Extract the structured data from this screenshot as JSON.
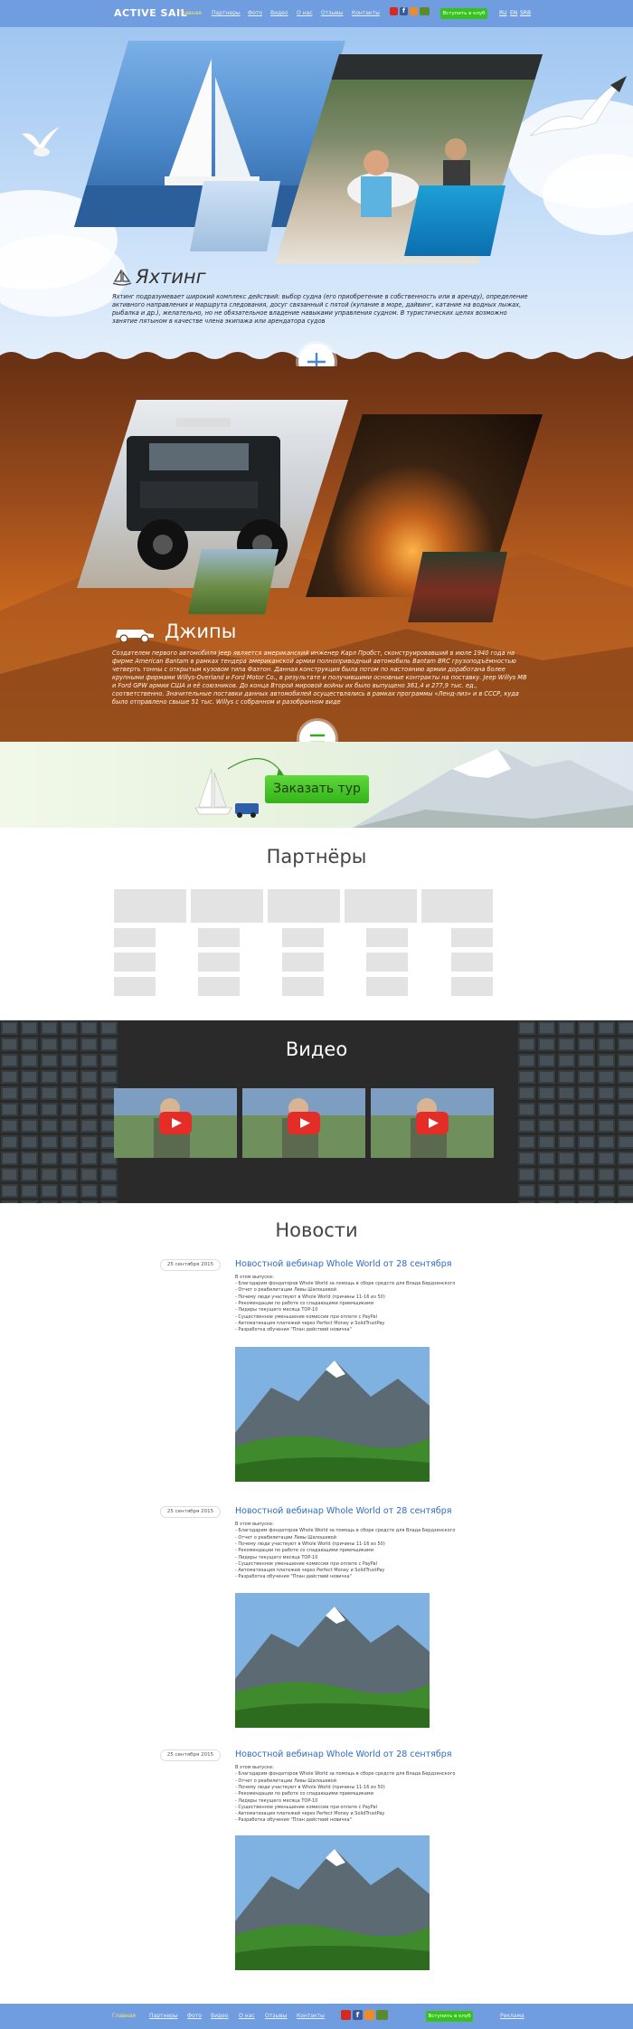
{
  "header": {
    "logo": "ACTIVE SAIL",
    "nav": [
      "Главная",
      "Партнеры",
      "Фото",
      "Видео",
      "О нас",
      "Отзывы",
      "Контакты"
    ],
    "join_label": "Вступить в клуб",
    "langs": [
      "RU",
      "EN",
      "SRB"
    ]
  },
  "yacht": {
    "title": "Яхтинг",
    "text": "Яхтинг подразумевает широкий комплекс действий: выбор судна (его приобретение в собственность или в аренду), определение активного направления и маршрута следования, досуг связанный с пятой (купание в море, дайвинг, катание на водных лыжах, рыбалка и др.), желательно, но не обязательное владение навыками управления судном. В туристических целях возможно занятие пятыном в качестве члена экипажа или арендатора судов"
  },
  "jeep": {
    "title": "Джипы",
    "text": "Создателем первого автомобиля Jeep является американский инженер Карл Пробст, сконструировавший в июле 1940 года на фирме American Bantam в рамках тендера американской армии полноприводный автомобиль Bantam BRC грузоподъёмностью четверть тонны с открытым кузовом типа Фаэтон. Данная конструкция была потом по настоянию армии доработана более крупными фирмами Willys-Overland и Ford Motor Co., в результате и получившими основные контракты на поставку. Jeep Willys MB и Ford GPW армии США и её союзников. До конца Второй мировой войны их было выпущено 361,4 и 277,9 тыс. ед., соответственно. Значительные поставки данных автомобилей осуществлялись в рамках программы «Ленд-лиз» и в СССР, куда было отправлено свыше 51 тыс. Willys с собранном и разобранном виде"
  },
  "order": {
    "button_label": "Заказать тур"
  },
  "partners": {
    "title": "Партнёры"
  },
  "video": {
    "title": "Видео"
  },
  "news": {
    "title": "Новости",
    "items": [
      {
        "date": "25 сентября 2015",
        "title": "Новостной вебинар Whole World от 28 сентября",
        "lines": [
          "В этом выпуске:",
          "- Благодарим фондаторов Whole World за помощь в сборе средств для Влада Бердзенского",
          "- Отчет о реабилитации Левы Шапошевой",
          "- Почему люди участвуют в Whole World (причины 11-16 из 50)",
          "- Рекомендации по работе со спадающими приемщиками",
          "- Лидеры текущего месяца TOP-10",
          "- Существенное уменьшение комиссии при оплате с PayPal",
          "- Автоматизация платежей через Perfect Money и SolidTrustPay",
          "- Разработка обучения \"План действий новичка\""
        ]
      },
      {
        "date": "25 сентября 2015",
        "title": "Новостной вебинар Whole World от 28 сентября",
        "lines": [
          "В этом выпуске:",
          "- Благодарим фондаторов Whole World за помощь в сборе средств для Влада Бердзенского",
          "- Отчет о реабилитации Левы Шапошевой",
          "- Почему люди участвуют в Whole World (причины 11-16 из 50)",
          "- Рекомендации по работе со спадающими приемщиками",
          "- Лидеры текущего месяца TOP-10",
          "- Существенное уменьшение комиссии при оплате с PayPal",
          "- Автоматизация платежей через Perfect Money и SolidTrustPay",
          "- Разработка обучения \"План действий новичка\""
        ]
      },
      {
        "date": "25 сентября 2015",
        "title": "Новостной вебинар Whole World от 28 сентября",
        "lines": [
          "В этом выпуске:",
          "- Благодарим фондаторов Whole World за помощь в сборе средств для Влада Бердзенского",
          "- Отчет о реабилитации Левы Шапошевой",
          "- Почему люди участвуют в Whole World (причины 11-16 из 50)",
          "- Рекомендации по работе со спадающими приемщиками",
          "- Лидеры текущего месяца TOP-10",
          "- Существенное уменьшение комиссии при оплате с PayPal",
          "- Автоматизация платежей через Perfect Money и SolidTrustPay",
          "- Разработка обучения \"План действий новичка\""
        ]
      }
    ]
  },
  "footer": {
    "nav": [
      "Главная",
      "Партнеры",
      "Фото",
      "Видео",
      "О нас",
      "Отзывы",
      "Контакты"
    ],
    "join_label": "Вступить в клуб",
    "ads_label": "Реклама"
  },
  "icons": {
    "youtube": "youtube-icon",
    "facebook": "facebook-icon",
    "odnoklassniki": "odnoklassniki-icon",
    "vk": "vk-icon",
    "plus": "plus-icon",
    "equals": "equals-icon",
    "play": "play-icon",
    "sailboat": "sailboat-icon",
    "jeep": "jeep-icon"
  },
  "colors": {
    "header": "#6f9de0",
    "accent_green": "#37c31b",
    "link_blue": "#2d6bc4",
    "active_nav": "#ffe66a"
  }
}
